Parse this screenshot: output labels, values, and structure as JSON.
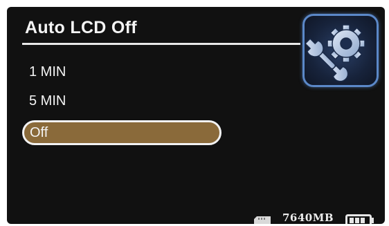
{
  "header": {
    "title": "Auto LCD Off"
  },
  "settings_icon": {
    "icon": "gear-wrench-icon"
  },
  "menu": {
    "items": [
      {
        "label": "1 MIN",
        "selected": false
      },
      {
        "label": "5 MIN",
        "selected": false
      },
      {
        "label": "Off",
        "selected": true
      }
    ]
  },
  "statusbar": {
    "sd_icon": "sd-card-icon",
    "storage": "7640MB",
    "battery_icon": "battery-icon"
  },
  "colors": {
    "background": "#111111",
    "text": "#f4f4f4",
    "selection": "#8a6a3a",
    "icon_frame": "#5b88c8"
  }
}
